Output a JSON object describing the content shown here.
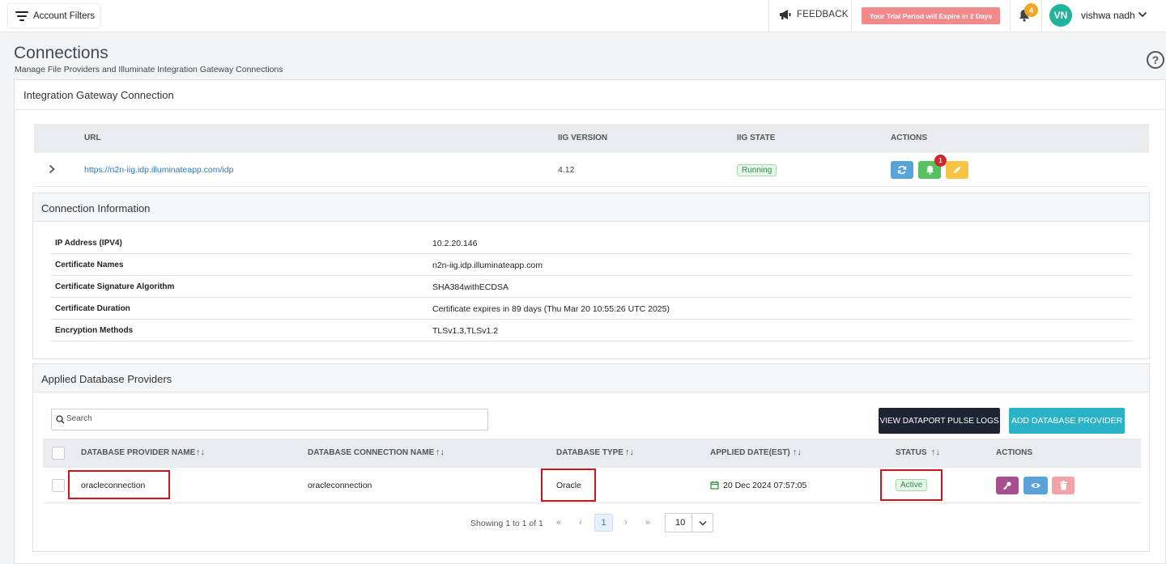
{
  "topbar": {
    "filters_label": "Account Filters",
    "feedback_label": "FEEDBACK",
    "trial_text": "Your Trial Period will Expire in 2 Days",
    "notification_count": "4",
    "avatar_initials": "VN",
    "user_name": "vishwa nadh"
  },
  "page": {
    "title": "Connections",
    "subtitle": "Manage File Providers and Illuminate Integration Gateway Connections",
    "help_symbol": "?"
  },
  "gateway": {
    "section_title": "Integration Gateway Connection",
    "columns": {
      "url": "URL",
      "version": "IIG VERSION",
      "state": "IIG STATE",
      "actions": "ACTIONS"
    },
    "row": {
      "url": "https://n2n-iig.idp.illuminateapp.com/idp",
      "version": "4.12",
      "state": "Running",
      "alert_count": "1"
    }
  },
  "connection_info": {
    "title": "Connection Information",
    "rows": [
      {
        "label": "IP Address (IPV4)",
        "value": "10.2.20.146"
      },
      {
        "label": "Certificate Names",
        "value": "n2n-iig.idp.illuminateapp.com"
      },
      {
        "label": "Certificate Signature Algorithm",
        "value": "SHA384withECDSA"
      },
      {
        "label": "Certificate Duration",
        "value": "Certificate expires in 89 days (Thu Mar 20 10:55:26 UTC 2025)"
      },
      {
        "label": "Encryption Methods",
        "value": "TLSv1.3,TLSv1.2"
      }
    ]
  },
  "providers": {
    "title": "Applied Database Providers",
    "search_placeholder": "Search",
    "view_logs_label": "VIEW DATAPORT PULSE LOGS",
    "add_provider_label": "ADD DATABASE PROVIDER",
    "columns": {
      "provider_name": "DATABASE PROVIDER NAME",
      "connection_name": "DATABASE CONNECTION NAME",
      "db_type": "DATABASE TYPE",
      "applied_date": "APPLIED DATE(EST)",
      "status": "STATUS",
      "actions": "ACTIONS"
    },
    "sort_glyph": "↑↓",
    "row": {
      "provider_name": "oracleconnection",
      "connection_name": "oracleconnection",
      "db_type": "Oracle",
      "applied_date": "20 Dec 2024 07:57:05",
      "status": "Active"
    }
  },
  "pagination": {
    "summary": "Showing 1 to 1 of 1",
    "first": "«",
    "prev": "‹",
    "current_page": "1",
    "next": "›",
    "last": "»",
    "page_size": "10"
  },
  "colors": {
    "accent_teal": "#2ab2c7",
    "dark_button": "#1c2433",
    "trial_banner": "#f3898b",
    "highlight_box": "#d3121c",
    "status_green": "#2f8a3f"
  }
}
